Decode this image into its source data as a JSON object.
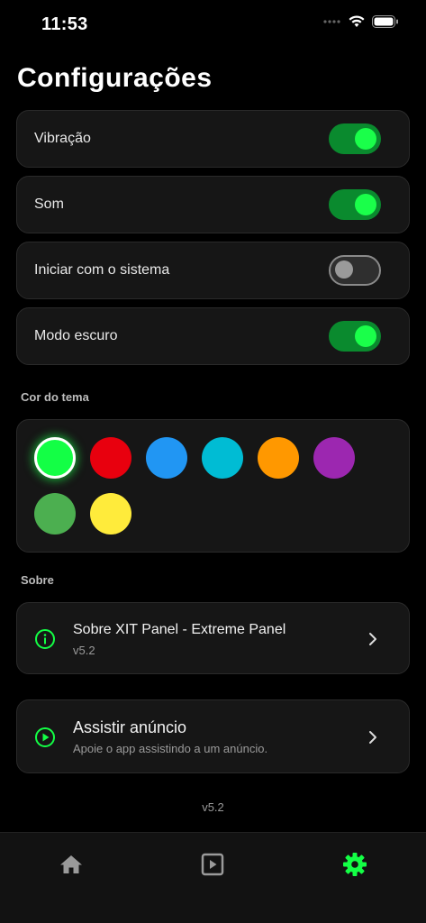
{
  "status_bar": {
    "time": "11:53"
  },
  "page": {
    "title": "Configurações"
  },
  "settings": [
    {
      "label": "Vibração",
      "enabled": true
    },
    {
      "label": "Som",
      "enabled": true
    },
    {
      "label": "Iniciar com o sistema",
      "enabled": false
    },
    {
      "label": "Modo escuro",
      "enabled": true
    }
  ],
  "theme": {
    "section_label": "Cor do tema",
    "selected_index": 0,
    "colors": [
      "#13ff45",
      "#e8000e",
      "#2196f3",
      "#00bcd4",
      "#ff9800",
      "#9c27b0",
      "#4caf50",
      "#ffeb3b"
    ]
  },
  "about": {
    "section_label": "Sobre",
    "app_info": {
      "icon": "info-icon",
      "title": "Sobre XIT Panel - Extreme Panel",
      "subtitle": "v5.2"
    },
    "ad": {
      "icon": "play-circle-icon",
      "title": "Assistir anúncio",
      "subtitle": "Apoie o app assistindo a um anúncio."
    }
  },
  "footer": {
    "version": "v5.2"
  },
  "nav": {
    "items": [
      {
        "icon": "home-icon",
        "active": false
      },
      {
        "icon": "play-square-icon",
        "active": false
      },
      {
        "icon": "gear-icon",
        "active": true
      }
    ],
    "active_color": "#13ff45",
    "inactive_color": "#9a9a9a"
  },
  "accent_color": "#13ff45"
}
